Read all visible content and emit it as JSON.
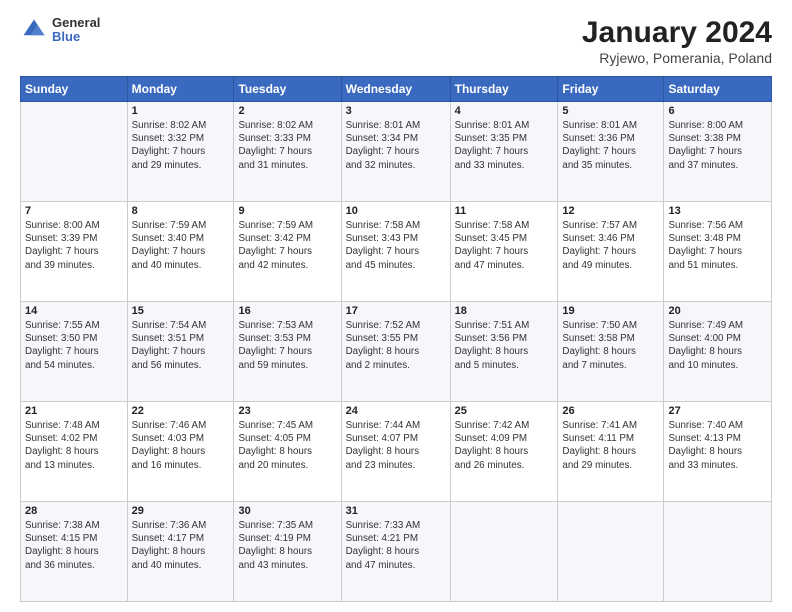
{
  "logo": {
    "general": "General",
    "blue": "Blue"
  },
  "title": "January 2024",
  "subtitle": "Ryjewo, Pomerania, Poland",
  "header_days": [
    "Sunday",
    "Monday",
    "Tuesday",
    "Wednesday",
    "Thursday",
    "Friday",
    "Saturday"
  ],
  "weeks": [
    [
      {
        "day": "",
        "info": ""
      },
      {
        "day": "1",
        "info": "Sunrise: 8:02 AM\nSunset: 3:32 PM\nDaylight: 7 hours\nand 29 minutes."
      },
      {
        "day": "2",
        "info": "Sunrise: 8:02 AM\nSunset: 3:33 PM\nDaylight: 7 hours\nand 31 minutes."
      },
      {
        "day": "3",
        "info": "Sunrise: 8:01 AM\nSunset: 3:34 PM\nDaylight: 7 hours\nand 32 minutes."
      },
      {
        "day": "4",
        "info": "Sunrise: 8:01 AM\nSunset: 3:35 PM\nDaylight: 7 hours\nand 33 minutes."
      },
      {
        "day": "5",
        "info": "Sunrise: 8:01 AM\nSunset: 3:36 PM\nDaylight: 7 hours\nand 35 minutes."
      },
      {
        "day": "6",
        "info": "Sunrise: 8:00 AM\nSunset: 3:38 PM\nDaylight: 7 hours\nand 37 minutes."
      }
    ],
    [
      {
        "day": "7",
        "info": "Sunrise: 8:00 AM\nSunset: 3:39 PM\nDaylight: 7 hours\nand 39 minutes."
      },
      {
        "day": "8",
        "info": "Sunrise: 7:59 AM\nSunset: 3:40 PM\nDaylight: 7 hours\nand 40 minutes."
      },
      {
        "day": "9",
        "info": "Sunrise: 7:59 AM\nSunset: 3:42 PM\nDaylight: 7 hours\nand 42 minutes."
      },
      {
        "day": "10",
        "info": "Sunrise: 7:58 AM\nSunset: 3:43 PM\nDaylight: 7 hours\nand 45 minutes."
      },
      {
        "day": "11",
        "info": "Sunrise: 7:58 AM\nSunset: 3:45 PM\nDaylight: 7 hours\nand 47 minutes."
      },
      {
        "day": "12",
        "info": "Sunrise: 7:57 AM\nSunset: 3:46 PM\nDaylight: 7 hours\nand 49 minutes."
      },
      {
        "day": "13",
        "info": "Sunrise: 7:56 AM\nSunset: 3:48 PM\nDaylight: 7 hours\nand 51 minutes."
      }
    ],
    [
      {
        "day": "14",
        "info": "Sunrise: 7:55 AM\nSunset: 3:50 PM\nDaylight: 7 hours\nand 54 minutes."
      },
      {
        "day": "15",
        "info": "Sunrise: 7:54 AM\nSunset: 3:51 PM\nDaylight: 7 hours\nand 56 minutes."
      },
      {
        "day": "16",
        "info": "Sunrise: 7:53 AM\nSunset: 3:53 PM\nDaylight: 7 hours\nand 59 minutes."
      },
      {
        "day": "17",
        "info": "Sunrise: 7:52 AM\nSunset: 3:55 PM\nDaylight: 8 hours\nand 2 minutes."
      },
      {
        "day": "18",
        "info": "Sunrise: 7:51 AM\nSunset: 3:56 PM\nDaylight: 8 hours\nand 5 minutes."
      },
      {
        "day": "19",
        "info": "Sunrise: 7:50 AM\nSunset: 3:58 PM\nDaylight: 8 hours\nand 7 minutes."
      },
      {
        "day": "20",
        "info": "Sunrise: 7:49 AM\nSunset: 4:00 PM\nDaylight: 8 hours\nand 10 minutes."
      }
    ],
    [
      {
        "day": "21",
        "info": "Sunrise: 7:48 AM\nSunset: 4:02 PM\nDaylight: 8 hours\nand 13 minutes."
      },
      {
        "day": "22",
        "info": "Sunrise: 7:46 AM\nSunset: 4:03 PM\nDaylight: 8 hours\nand 16 minutes."
      },
      {
        "day": "23",
        "info": "Sunrise: 7:45 AM\nSunset: 4:05 PM\nDaylight: 8 hours\nand 20 minutes."
      },
      {
        "day": "24",
        "info": "Sunrise: 7:44 AM\nSunset: 4:07 PM\nDaylight: 8 hours\nand 23 minutes."
      },
      {
        "day": "25",
        "info": "Sunrise: 7:42 AM\nSunset: 4:09 PM\nDaylight: 8 hours\nand 26 minutes."
      },
      {
        "day": "26",
        "info": "Sunrise: 7:41 AM\nSunset: 4:11 PM\nDaylight: 8 hours\nand 29 minutes."
      },
      {
        "day": "27",
        "info": "Sunrise: 7:40 AM\nSunset: 4:13 PM\nDaylight: 8 hours\nand 33 minutes."
      }
    ],
    [
      {
        "day": "28",
        "info": "Sunrise: 7:38 AM\nSunset: 4:15 PM\nDaylight: 8 hours\nand 36 minutes."
      },
      {
        "day": "29",
        "info": "Sunrise: 7:36 AM\nSunset: 4:17 PM\nDaylight: 8 hours\nand 40 minutes."
      },
      {
        "day": "30",
        "info": "Sunrise: 7:35 AM\nSunset: 4:19 PM\nDaylight: 8 hours\nand 43 minutes."
      },
      {
        "day": "31",
        "info": "Sunrise: 7:33 AM\nSunset: 4:21 PM\nDaylight: 8 hours\nand 47 minutes."
      },
      {
        "day": "",
        "info": ""
      },
      {
        "day": "",
        "info": ""
      },
      {
        "day": "",
        "info": ""
      }
    ]
  ]
}
